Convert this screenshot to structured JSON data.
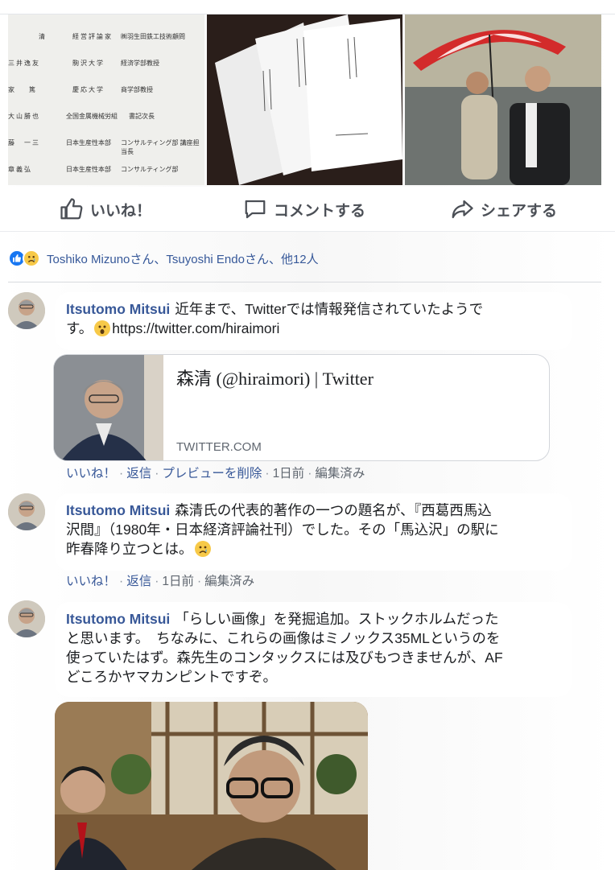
{
  "photo_strip": {
    "doc_rows": [
      {
        "name": "清",
        "title": "経 営 評 論 家",
        "org": "㈱羽生田鉄工技術顧問"
      },
      {
        "name": "三 井 逸 友",
        "title": "駒 沢 大 学",
        "org": "経済学部教授"
      },
      {
        "name": "家　　 篤",
        "title": "慶 応 大 学",
        "org": "商学部教授"
      },
      {
        "name": "大 山 勝 也",
        "title": "全国金属機械労組",
        "org": "書記次長"
      },
      {
        "name": "藤 　 一 三",
        "title": "日本生産性本部",
        "org": "コンサルティング部 講座担当長"
      },
      {
        "name": "章 義 弘",
        "title": "日本生産性本部",
        "org": "コンサルティング部"
      }
    ]
  },
  "actions": {
    "like": "いいね！",
    "comment": "コメントする",
    "share": "シェアする"
  },
  "reactions": {
    "text": "Toshiko Mizunoさん、Tsuyoshi Endoさん、他12人"
  },
  "comments": [
    {
      "author": "Itsutomo Mitsui",
      "text_line1": "近年まで、Twitterでは情報発信されていたようで",
      "text_line2": "す。",
      "link": "https://twitter.com/hiraimori",
      "actions": {
        "like": "いいね！",
        "reply": "返信",
        "remove_preview": "プレビューを削除",
        "time": "1日前",
        "edited": "編集済み"
      }
    },
    {
      "author": "Itsutomo Mitsui",
      "text_line1": "森清氏の代表的著作の一つの題名が、『西葛西馬込",
      "text_line2": "沢間』（1980年・日本経済評論社刊）でした。その「馬込沢」の駅に",
      "text_line3": "昨春降り立つとは。",
      "actions": {
        "like": "いいね！",
        "reply": "返信",
        "time": "1日前",
        "edited": "編集済み"
      }
    },
    {
      "author": "Itsutomo Mitsui",
      "text_line1": "「らしい画像」を発掘追加。ストックホルムだった",
      "text_line2": "と思います。　ちなみに、これらの画像はミノックス35MLというのを",
      "text_line3": "使っていたはず。森先生のコンタックスには及びもつきませんが、AF",
      "text_line4": "どころかヤマカンピントですぞ。"
    }
  ],
  "link_preview": {
    "title": "森清 (@hiraimori) | Twitter",
    "domain": "TWITTER.COM"
  },
  "colors": {
    "link_blue": "#385898",
    "meta_gray": "#606770",
    "like_blue": "#1877f2",
    "sad_yellow": "#f7c948"
  }
}
